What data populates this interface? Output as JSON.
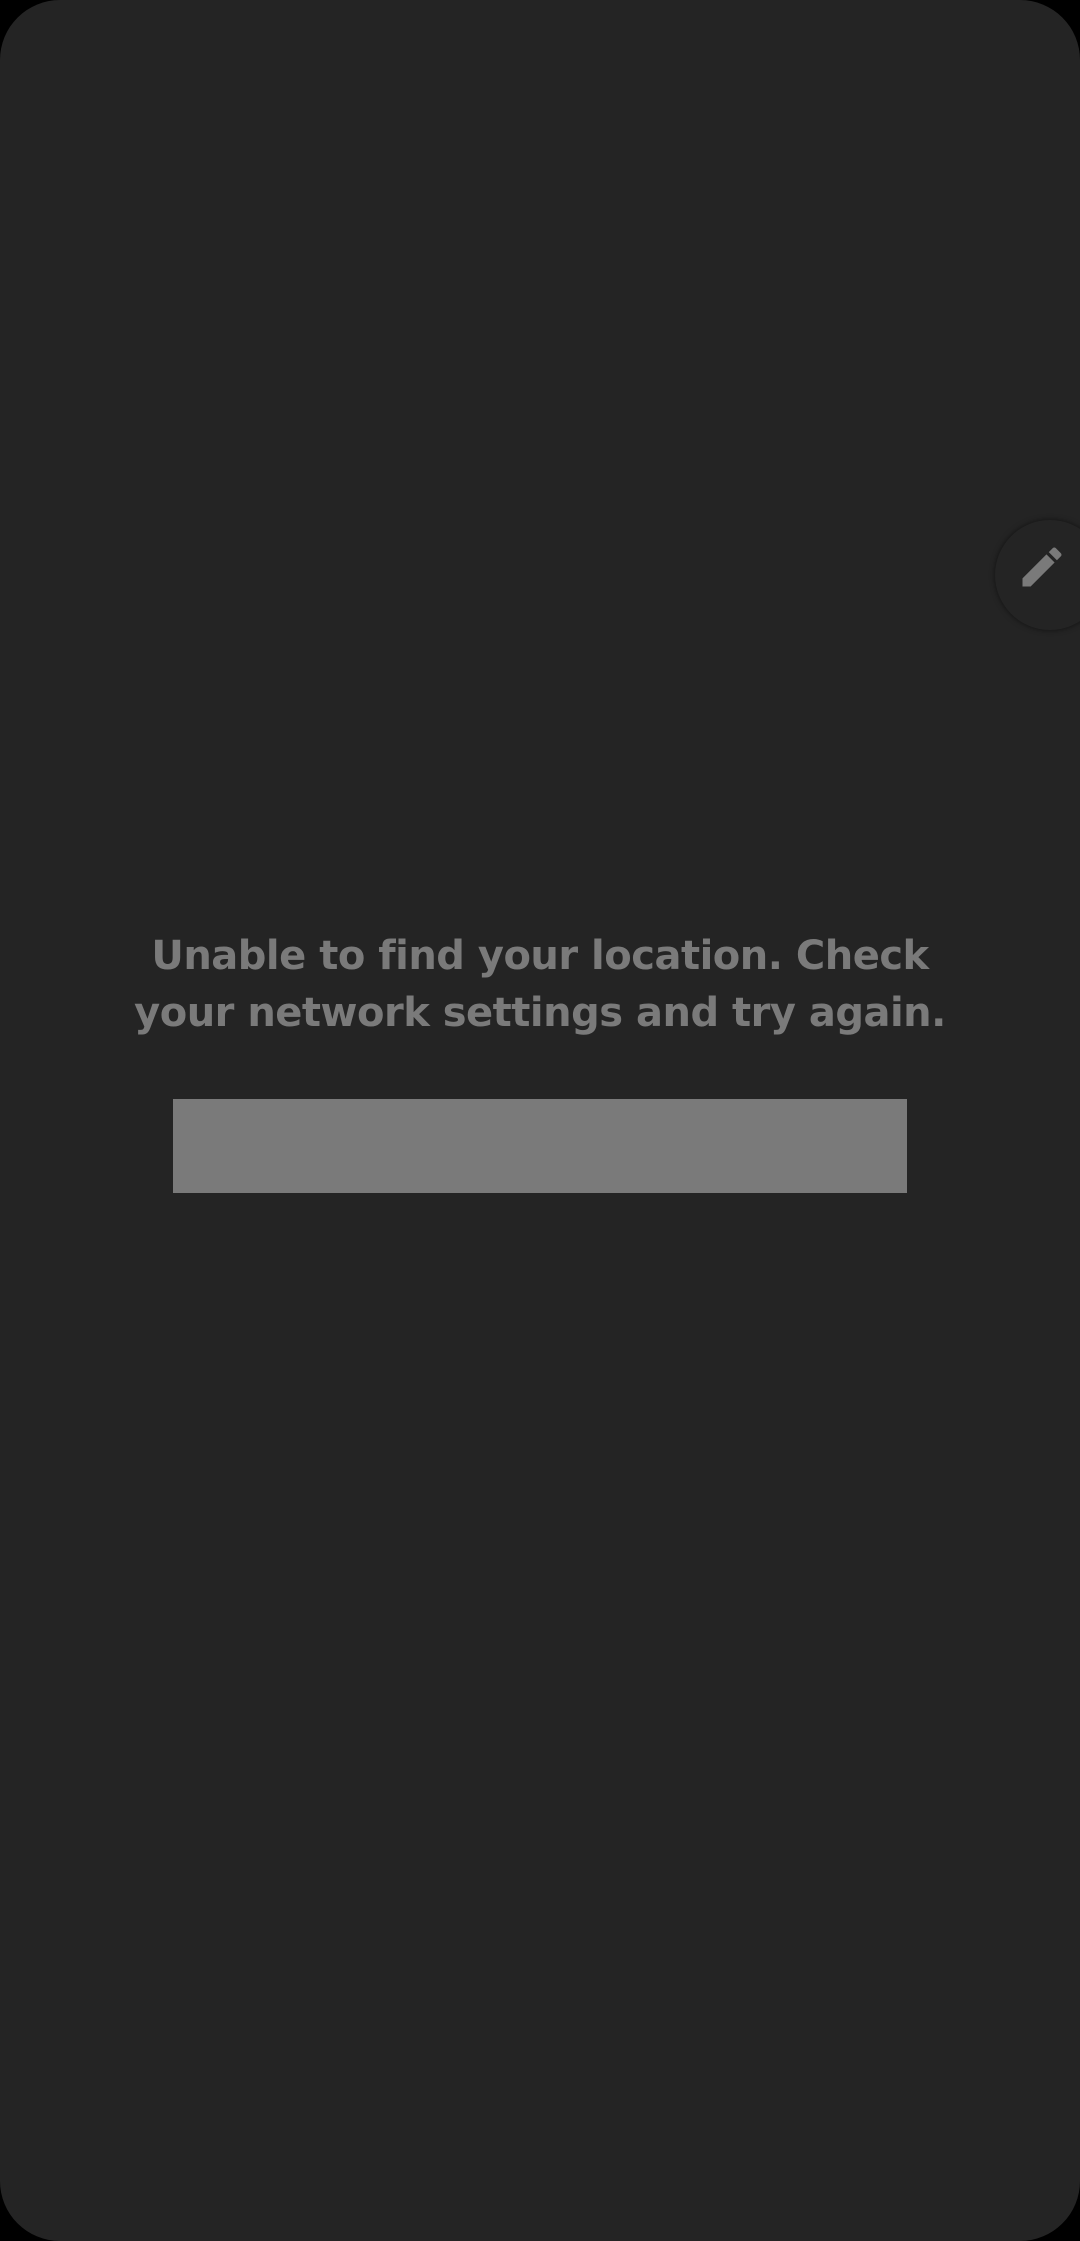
{
  "error": {
    "message": "Unable to find your location. Check your network settings and try again."
  },
  "action_button": {
    "label": ""
  },
  "icons": {
    "edit": "pencil-icon"
  },
  "colors": {
    "background": "#242424",
    "text": "#7a7a7a",
    "button": "#7a7a7a"
  }
}
